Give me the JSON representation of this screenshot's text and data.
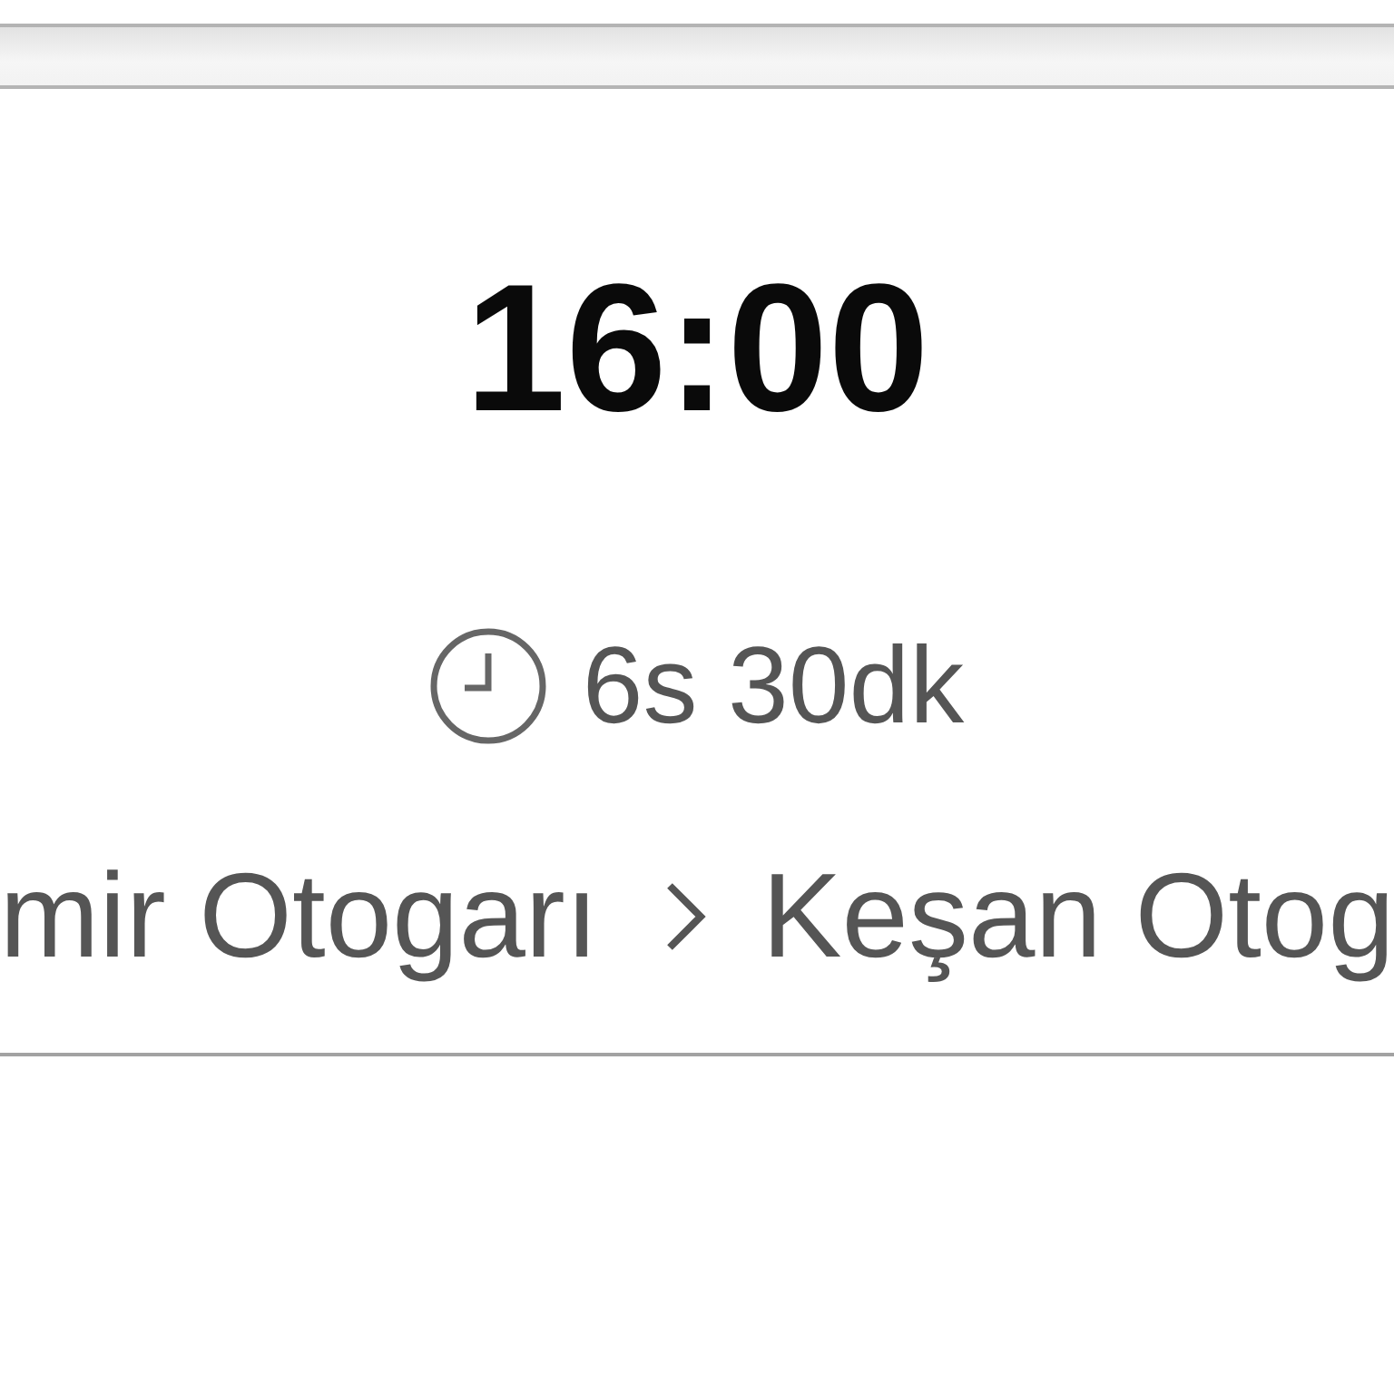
{
  "trip": {
    "departure_time": "16:00",
    "duration": "6s 30dk",
    "route": {
      "origin": "mir Otogarı",
      "destination": "Keşan Otog"
    }
  }
}
